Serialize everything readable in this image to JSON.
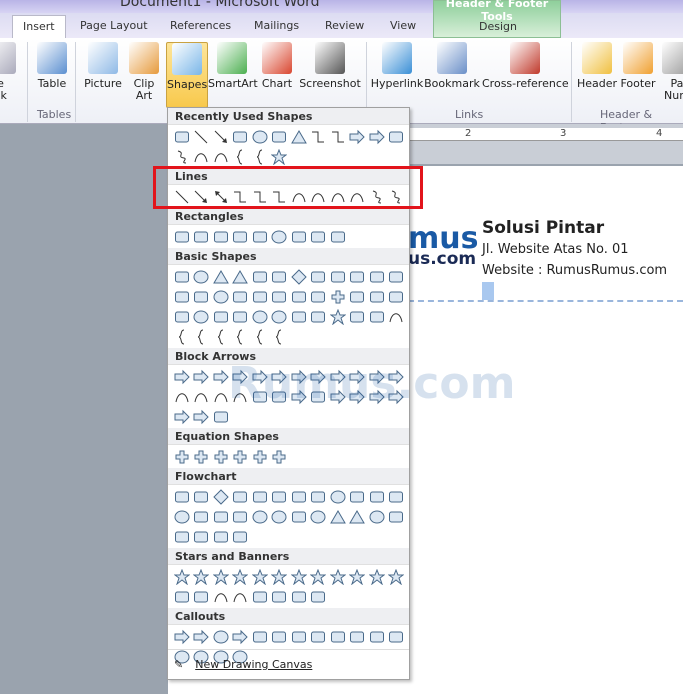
{
  "window": {
    "title": "Document1 - Microsoft Word",
    "context_tab_group": "Header & Footer Tools"
  },
  "tabs": [
    {
      "label": "Insert",
      "active": true
    },
    {
      "label": "Page Layout"
    },
    {
      "label": "References"
    },
    {
      "label": "Mailings"
    },
    {
      "label": "Review"
    },
    {
      "label": "View"
    },
    {
      "label": "Design"
    }
  ],
  "ribbon": {
    "buttons": [
      {
        "label": "ge\neak"
      },
      {
        "label": "Table"
      },
      {
        "label": "Picture"
      },
      {
        "label": "Clip\nArt"
      },
      {
        "label": "Shapes",
        "selected": true
      },
      {
        "label": "SmartArt"
      },
      {
        "label": "Chart"
      },
      {
        "label": "Screenshot"
      },
      {
        "label": "Hyperlink"
      },
      {
        "label": "Bookmark"
      },
      {
        "label": "Cross-reference"
      },
      {
        "label": "Header"
      },
      {
        "label": "Footer"
      },
      {
        "label": "Pa\nNum"
      }
    ],
    "groups": [
      "Tables",
      "Links",
      "Header & Foote"
    ]
  },
  "ruler": {
    "labels": [
      "2",
      "3",
      "4"
    ]
  },
  "document": {
    "logo": "RumusRumus.com",
    "logo_top": "mus",
    "logo_bottom": "us.com",
    "name": "Solusi  Pintar",
    "address": "Jl. Website Atas No. 01",
    "website": "Website : RumusRumus.com",
    "watermark": "Rumus.com"
  },
  "accent": {
    "highlight": "#e2141b",
    "selected_button": "#f8c94c"
  },
  "shapes_menu": {
    "sections": [
      {
        "title": "Recently Used Shapes",
        "shapes": [
          "textbox",
          "line",
          "arrow",
          "rect",
          "ellipse",
          "roundrect",
          "triangle",
          "elbow",
          "elbow-arrow",
          "right-arrow",
          "down-arrow",
          "wave",
          "scribble",
          "arc",
          "curve",
          "left-brace",
          "right-brace",
          "star"
        ]
      },
      {
        "title": "Lines",
        "shapes": [
          "line",
          "arrow",
          "double-arrow",
          "elbow",
          "elbow-arrow",
          "elbow-double-arrow",
          "curve-connector",
          "curve-arrow",
          "curve-double-arrow",
          "curve",
          "freeform",
          "scribble"
        ]
      },
      {
        "title": "Rectangles",
        "shapes": [
          "rect",
          "roundrect",
          "snip",
          "snip2",
          "snipround",
          "roundcorner",
          "rect",
          "roundrect",
          "roundrect"
        ]
      },
      {
        "title": "Basic Shapes",
        "shapes": [
          "textbox",
          "ellipse",
          "triangle",
          "right-triangle",
          "parallelogram",
          "trapezoid",
          "diamond",
          "pentagon",
          "hexagon",
          "heptagon",
          "octagon",
          "decagon",
          "dodecagon",
          "pie",
          "chord",
          "teardrop",
          "frame",
          "halfframe",
          "lshape",
          "diagstripe",
          "plus",
          "plaque",
          "can",
          "cube",
          "bevel",
          "donut",
          "nosymbol",
          "blockarc",
          "foldedcorner",
          "smiley",
          "heart",
          "lightning",
          "sun",
          "moon",
          "cloud",
          "arc",
          "bracketpair",
          "bracepair",
          "left-bracket",
          "right-bracket",
          "left-brace",
          "right-brace"
        ]
      },
      {
        "title": "Block Arrows",
        "shapes": [
          "right-arrow",
          "left-arrow",
          "up-arrow",
          "down-arrow",
          "leftright-arrow",
          "updown-arrow",
          "quad-arrow",
          "leftrightup-arrow",
          "bent-arrow",
          "uturn-arrow",
          "leftup-arrow",
          "bentup-arrow",
          "curved-right",
          "curved-left",
          "curved-up",
          "curved-down",
          "striped-right",
          "notched-right",
          "pentagon-arrow",
          "chevron",
          "right-callout",
          "down-callout",
          "left-callout",
          "up-callout",
          "quad-callout",
          "circular-arrow",
          "uturn"
        ]
      },
      {
        "title": "Equation Shapes",
        "shapes": [
          "plus",
          "minus",
          "multiply",
          "divide",
          "equal",
          "notequal"
        ]
      },
      {
        "title": "Flowchart",
        "shapes": [
          "rect",
          "roundrect",
          "diamond",
          "parallelogram",
          "predefined",
          "internal",
          "document",
          "multidocument",
          "terminator",
          "preparation",
          "manualinput",
          "manualop",
          "ellipse",
          "offpage",
          "card",
          "punchedtape",
          "summing",
          "or",
          "collate",
          "sort",
          "extract",
          "merge",
          "storeddata",
          "delay",
          "sequential",
          "magneticdisk",
          "directaccess",
          "display"
        ]
      },
      {
        "title": "Stars and Banners",
        "shapes": [
          "explosion1",
          "explosion2",
          "star4",
          "star5",
          "star6",
          "star7",
          "star8",
          "star10",
          "star12",
          "star16",
          "star24",
          "star32",
          "ribbon-up",
          "ribbon-down",
          "curved-ribbon-up",
          "curved-ribbon-down",
          "scroll-v",
          "scroll-h",
          "wave",
          "doublewave"
        ]
      },
      {
        "title": "Callouts",
        "shapes": [
          "rect-callout",
          "roundrect-callout",
          "oval-callout",
          "cloud-callout",
          "line-callout1",
          "line-callout2",
          "line-callout3",
          "line-callout4",
          "accent-callout1",
          "accent-callout2",
          "accent-callout3",
          "accent-callout4",
          "border-callout1",
          "border-callout2",
          "border-callout3",
          "border-callout4"
        ]
      }
    ],
    "footer": "New Drawing Canvas"
  }
}
